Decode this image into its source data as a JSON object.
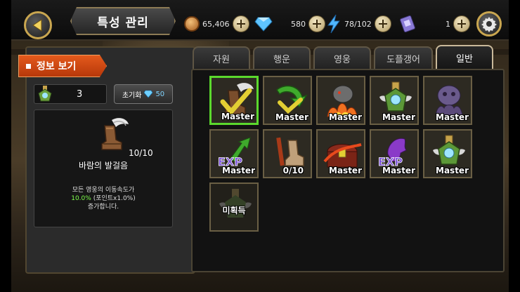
{
  "header": {
    "title": "특성 관리"
  },
  "resources": {
    "gold": "65,406",
    "gems": "580",
    "stamina": "78/102",
    "tickets": "1"
  },
  "info": {
    "heading": "정보 보기",
    "points": "3",
    "reset_label": "초기화",
    "reset_cost": "50",
    "selected": {
      "level": "10/10",
      "name": "바람의 발걸음",
      "desc_line1": "모든 영웅의 이동속도가",
      "desc_highlight": "10.0%",
      "desc_line2_rest": " (포인트x1.0%)",
      "desc_line3": "증가합니다."
    }
  },
  "tabs": [
    {
      "label": "자원",
      "active": false
    },
    {
      "label": "행운",
      "active": false
    },
    {
      "label": "영웅",
      "active": false
    },
    {
      "label": "도플갱어",
      "active": false
    },
    {
      "label": "일반",
      "active": true
    }
  ],
  "traits": [
    {
      "icon": "winged-boots-icon",
      "label": "Master"
    },
    {
      "icon": "green-arrow-icon",
      "label": "Master"
    },
    {
      "icon": "fire-beast-icon",
      "label": "Master"
    },
    {
      "icon": "medal-icon",
      "label": "Master"
    },
    {
      "icon": "ghost-icon",
      "label": "Master"
    },
    {
      "icon": "exp-arrow-icon",
      "label": "Master"
    },
    {
      "icon": "sword-boots-icon",
      "label": "0/10"
    },
    {
      "icon": "treasure-chest-icon",
      "label": "Master"
    },
    {
      "icon": "exp-horse-icon",
      "label": "Master"
    },
    {
      "icon": "medal-icon",
      "label": "Master"
    },
    {
      "icon": "locked-medal-icon",
      "label": "미획득"
    }
  ]
}
